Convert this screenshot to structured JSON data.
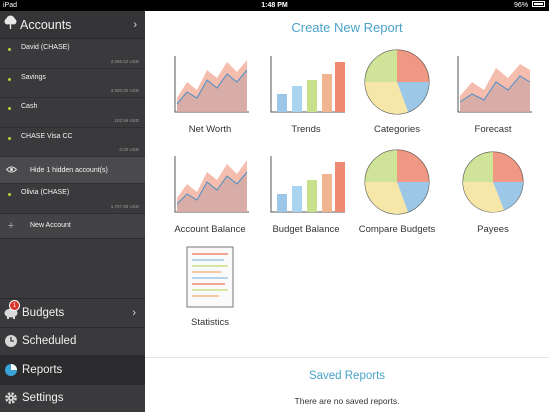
{
  "status": {
    "device": "iPad",
    "time": "1:48 PM",
    "battery": "96%"
  },
  "sidebar": {
    "accounts_title": "Accounts",
    "accounts": [
      {
        "name": "David (CHASE)",
        "amount": "2,096.52 USD"
      },
      {
        "name": "Savings",
        "amount": "3,920.00 USD"
      },
      {
        "name": "Cash",
        "amount": "102.59 USD"
      },
      {
        "name": "CHASE Visa CC",
        "amount": "0.00 USD"
      }
    ],
    "hide_label": "Hide 1 hidden account(s)",
    "extra_account": {
      "name": "Olivia (CHASE)",
      "amount": "1,707.85 USD"
    },
    "new_account_label": "New Account",
    "nav": {
      "budgets": "Budgets",
      "budgets_badge": "1",
      "scheduled": "Scheduled",
      "reports": "Reports",
      "settings": "Settings"
    }
  },
  "main": {
    "title": "Create New Report",
    "reports": [
      {
        "label": "Net Worth",
        "icon": "line-area-chart-icon"
      },
      {
        "label": "Trends",
        "icon": "bar-chart-icon"
      },
      {
        "label": "Categories",
        "icon": "pie-chart-icon"
      },
      {
        "label": "Forecast",
        "icon": "line-area-chart-icon"
      },
      {
        "label": "Account Balance",
        "icon": "line-area-chart-icon"
      },
      {
        "label": "Budget Balance",
        "icon": "bar-chart-icon"
      },
      {
        "label": "Compare Budgets",
        "icon": "pie-chart-icon"
      },
      {
        "label": "Payees",
        "icon": "pie-chart-icon"
      },
      {
        "label": "Statistics",
        "icon": "document-icon"
      }
    ],
    "saved_title": "Saved Reports",
    "saved_empty": "There are no saved reports."
  },
  "colors": {
    "accent": "#4aa3c8",
    "sidebar": "#3a3a3c",
    "dot": "#b7d23a",
    "badge": "#d8342b"
  }
}
